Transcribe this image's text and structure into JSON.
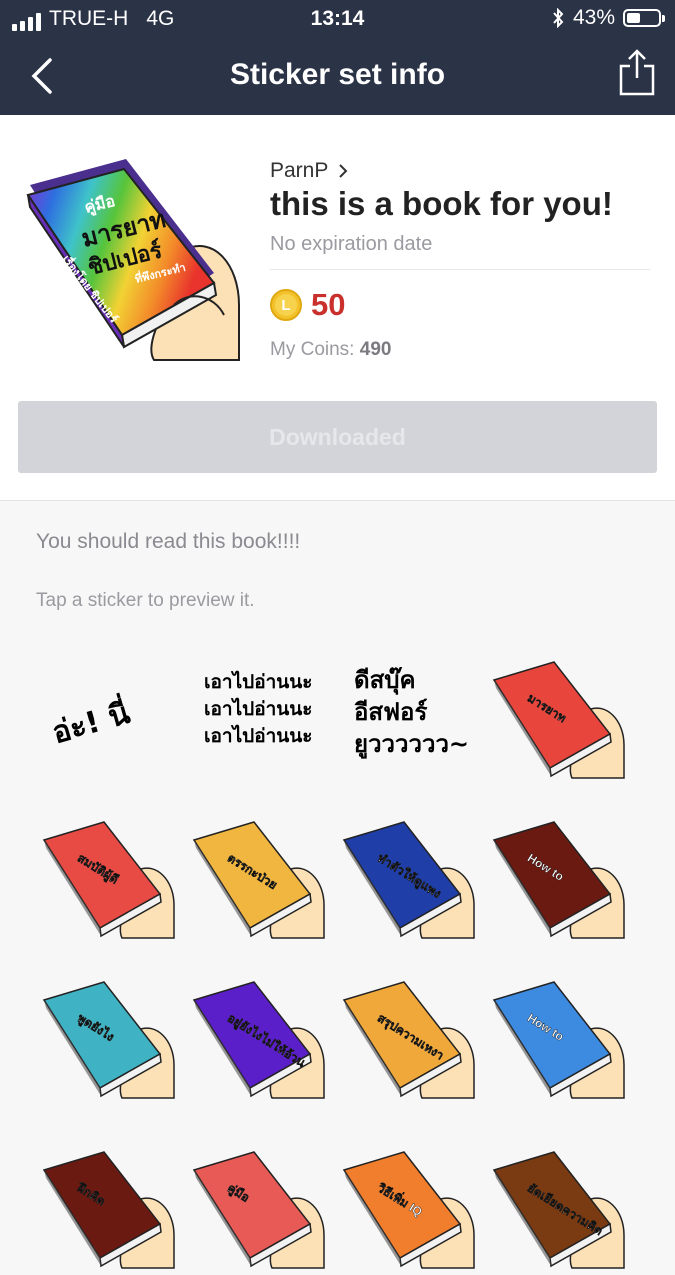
{
  "status_bar": {
    "carrier": "TRUE-H",
    "network": "4G",
    "time": "13:14",
    "battery": "43%",
    "battery_level": 0.43
  },
  "nav": {
    "title": "Sticker set info",
    "back_icon": "chevron-left-icon",
    "share_icon": "share-icon"
  },
  "sticker_set": {
    "author": "ParnP",
    "name": "this is a book for you!",
    "expiry": "No expiration date",
    "price": "50",
    "my_coins_label": "My Coins:",
    "my_coins_value": "490",
    "main_image_text": [
      "คู่มือ",
      "มารยาท",
      "ชิปเปอร์",
      "ที่พึงกระทำ",
      "เรื่องโดย ชิปเปอร์"
    ],
    "download_label": "Downloaded"
  },
  "description": "You should read this book!!!!",
  "hint": "Tap a sticker to preview it.",
  "stickers": [
    {
      "kind": "text",
      "lines": [
        "อ่ะ! นี่"
      ]
    },
    {
      "kind": "text",
      "lines": [
        "เอาไปอ่านนะ",
        "เอาไปอ่านนะ",
        "เอาไปอ่านนะ"
      ]
    },
    {
      "kind": "text",
      "lines": [
        "ดีสบุ๊ค",
        "อีสฟอร์",
        "ยูวววววว~"
      ]
    },
    {
      "kind": "book",
      "color": "#e8453c",
      "rainbow": true,
      "title": "มารยาท"
    },
    {
      "kind": "book",
      "color": "#e84b44",
      "title": "สมบัติผู้ดี"
    },
    {
      "kind": "book",
      "color": "#f1b63f",
      "title": "ตรรกะป่วย"
    },
    {
      "kind": "book",
      "color": "#1f3ea8",
      "title": "ทำตัวให้ดูแพง"
    },
    {
      "kind": "book",
      "color": "#6b1a12",
      "title": "How to"
    },
    {
      "kind": "book",
      "color": "#3fb3c4",
      "title": "พูดยังไง"
    },
    {
      "kind": "book",
      "color": "#5a1fc9",
      "title": "อยู่ยังไงไม่ให้อ้วน"
    },
    {
      "kind": "book",
      "color": "#f0a83a",
      "title": "สรุปความเหงา"
    },
    {
      "kind": "book",
      "color": "#3d8be0",
      "title": "How to"
    },
    {
      "kind": "book",
      "color": "#6b1a12",
      "title": "ฝึกคิด"
    },
    {
      "kind": "book",
      "color": "#e85a55",
      "title": "คู่มือ"
    },
    {
      "kind": "book",
      "color": "#f07e2c",
      "title": "วิธีเพิ่ม IQ"
    },
    {
      "kind": "book",
      "color": "#7a3a12",
      "title": "ยัดเยียดความคิด"
    }
  ]
}
